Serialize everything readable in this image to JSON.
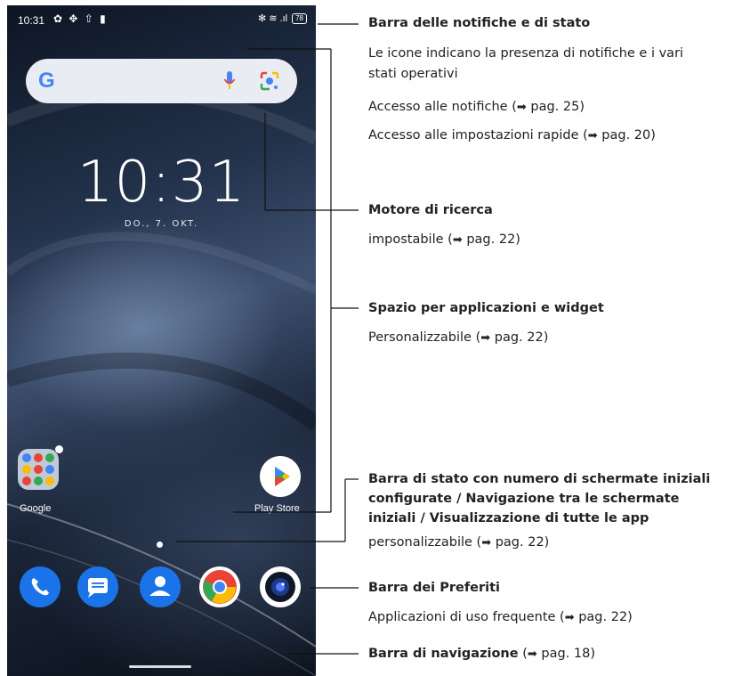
{
  "phone": {
    "status_time": "10:31",
    "status_left_icons": "✿ ✥ ⇧ ▮",
    "status_right_icons": "✻ ≋ .ıl",
    "battery": "78",
    "search_logo": "G",
    "clock": "10:31",
    "date": "DO., 7. OKT.",
    "folder_label": "Google",
    "play_label": "Play Store",
    "dock_apps": [
      "phone-icon",
      "messages-icon",
      "contacts-icon",
      "chrome-icon",
      "camera-icon"
    ],
    "colors": {
      "phone": "#1a73e8",
      "messages": "#1a73e8",
      "contacts": "#1a73e8",
      "search_bg": "#e9edf3"
    }
  },
  "annotations": {
    "status_bar": {
      "title": "Barra delle notifiche e di stato",
      "line1": "Le icone indicano la presenza di notifiche e i vari",
      "line2": "stati operativi",
      "line3": "Accesso alle notifiche (",
      "line3_ref": "pag. 25)",
      "line4": "Accesso alle impostazioni rapide (",
      "line4_ref": "pag. 20)"
    },
    "search": {
      "title": "Motore di ricerca",
      "line1": "impostabile (",
      "line1_ref": "pag. 22)"
    },
    "apps_space": {
      "title": "Spazio per applicazioni e widget",
      "line1": "Personalizzabile (",
      "line1_ref": "pag. 22)"
    },
    "home_status": {
      "title1": "Barra di stato con numero di schermate iniziali",
      "title2": "configurate / Navigazione tra le schermate",
      "title3": "iniziali / Visualizzazione di tutte le app",
      "line1": "personalizzabile (",
      "line1_ref": "pag. 22)"
    },
    "favorites": {
      "title": "Barra dei Preferiti",
      "line1": "Applicazioni di uso frequente (",
      "line1_ref": "pag. 22)"
    },
    "navigation": {
      "title": "Barra di navigazione",
      "line1": " (",
      "line1_ref": "pag. 18)"
    },
    "arrow": "➡"
  }
}
